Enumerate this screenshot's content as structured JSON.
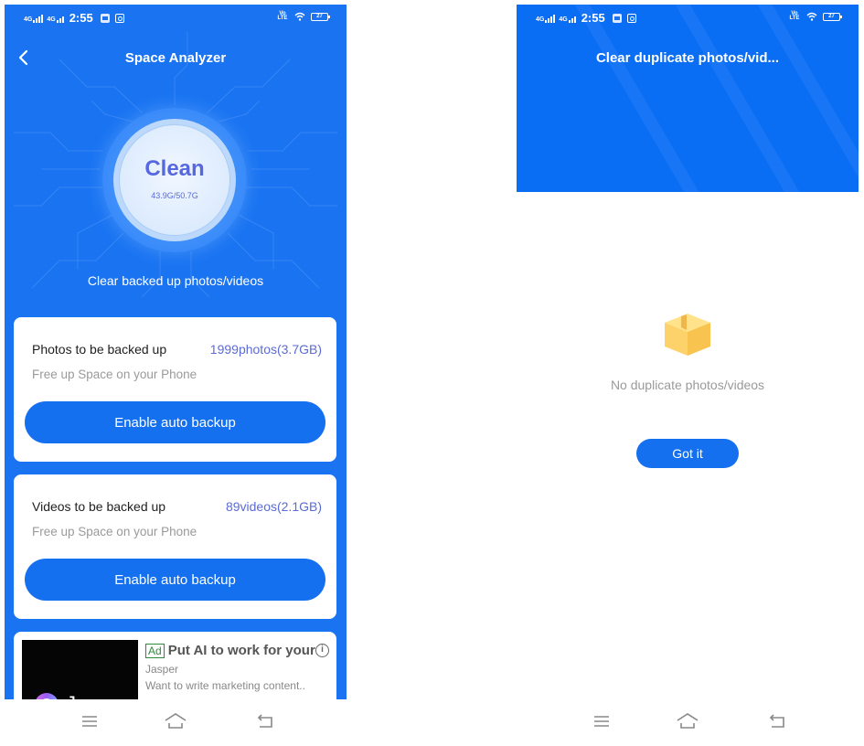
{
  "status_bar": {
    "network_1": "4G",
    "network_2": "4G",
    "time": "2:55",
    "volte": "Vo LTE",
    "battery": "27"
  },
  "left_screen": {
    "title": "Space Analyzer",
    "gauge": {
      "status": "Clean",
      "used_total": "43.9G/50.7G"
    },
    "caption": "Clear backed up photos/videos",
    "cards": [
      {
        "label": "Photos to be backed up",
        "value": "1999photos(3.7GB)",
        "subtitle": "Free up Space on your Phone",
        "button": "Enable auto backup"
      },
      {
        "label": "Videos to be backed up",
        "value": "89videos(2.1GB)",
        "subtitle": "Free up Space on your Phone",
        "button": "Enable auto backup"
      }
    ],
    "ad": {
      "badge": "Ad",
      "headline": "Put AI to work for your",
      "advertiser": "Jasper",
      "description": "Want to write marketing content..",
      "thumbnail_text": "Jasper",
      "info_icon": "i"
    }
  },
  "right_screen": {
    "title": "Clear duplicate photos/vid...",
    "empty_icon": "box-icon",
    "empty_message": "No duplicate photos/videos",
    "button": "Got it"
  },
  "nav_bar": {
    "icons": [
      "menu-icon",
      "home-icon",
      "back-icon"
    ]
  },
  "colors": {
    "primary_blue": "#1a74f2",
    "button_blue": "#1570f0",
    "accent_purple": "#5a6bd6",
    "muted_gray": "#9a9a9a",
    "box_yellow": "#fdd26a"
  }
}
